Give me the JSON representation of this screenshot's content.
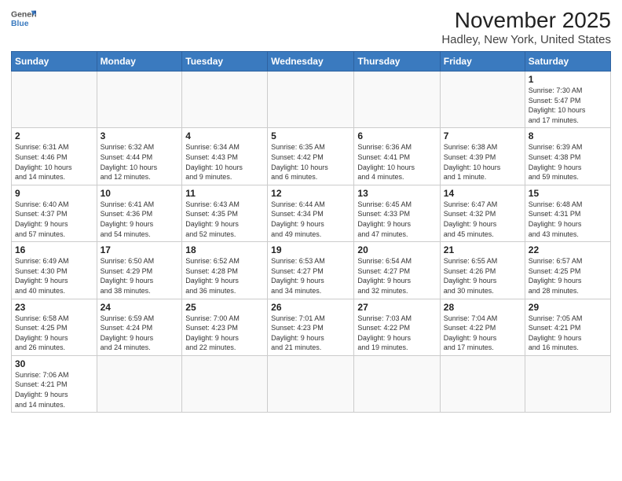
{
  "header": {
    "logo_line1": "General",
    "logo_line2": "Blue",
    "title": "November 2025",
    "subtitle": "Hadley, New York, United States"
  },
  "weekdays": [
    "Sunday",
    "Monday",
    "Tuesday",
    "Wednesday",
    "Thursday",
    "Friday",
    "Saturday"
  ],
  "weeks": [
    [
      {
        "day": "",
        "info": ""
      },
      {
        "day": "",
        "info": ""
      },
      {
        "day": "",
        "info": ""
      },
      {
        "day": "",
        "info": ""
      },
      {
        "day": "",
        "info": ""
      },
      {
        "day": "",
        "info": ""
      },
      {
        "day": "1",
        "info": "Sunrise: 7:30 AM\nSunset: 5:47 PM\nDaylight: 10 hours\nand 17 minutes."
      }
    ],
    [
      {
        "day": "2",
        "info": "Sunrise: 6:31 AM\nSunset: 4:46 PM\nDaylight: 10 hours\nand 14 minutes."
      },
      {
        "day": "3",
        "info": "Sunrise: 6:32 AM\nSunset: 4:44 PM\nDaylight: 10 hours\nand 12 minutes."
      },
      {
        "day": "4",
        "info": "Sunrise: 6:34 AM\nSunset: 4:43 PM\nDaylight: 10 hours\nand 9 minutes."
      },
      {
        "day": "5",
        "info": "Sunrise: 6:35 AM\nSunset: 4:42 PM\nDaylight: 10 hours\nand 6 minutes."
      },
      {
        "day": "6",
        "info": "Sunrise: 6:36 AM\nSunset: 4:41 PM\nDaylight: 10 hours\nand 4 minutes."
      },
      {
        "day": "7",
        "info": "Sunrise: 6:38 AM\nSunset: 4:39 PM\nDaylight: 10 hours\nand 1 minute."
      },
      {
        "day": "8",
        "info": "Sunrise: 6:39 AM\nSunset: 4:38 PM\nDaylight: 9 hours\nand 59 minutes."
      }
    ],
    [
      {
        "day": "9",
        "info": "Sunrise: 6:40 AM\nSunset: 4:37 PM\nDaylight: 9 hours\nand 57 minutes."
      },
      {
        "day": "10",
        "info": "Sunrise: 6:41 AM\nSunset: 4:36 PM\nDaylight: 9 hours\nand 54 minutes."
      },
      {
        "day": "11",
        "info": "Sunrise: 6:43 AM\nSunset: 4:35 PM\nDaylight: 9 hours\nand 52 minutes."
      },
      {
        "day": "12",
        "info": "Sunrise: 6:44 AM\nSunset: 4:34 PM\nDaylight: 9 hours\nand 49 minutes."
      },
      {
        "day": "13",
        "info": "Sunrise: 6:45 AM\nSunset: 4:33 PM\nDaylight: 9 hours\nand 47 minutes."
      },
      {
        "day": "14",
        "info": "Sunrise: 6:47 AM\nSunset: 4:32 PM\nDaylight: 9 hours\nand 45 minutes."
      },
      {
        "day": "15",
        "info": "Sunrise: 6:48 AM\nSunset: 4:31 PM\nDaylight: 9 hours\nand 43 minutes."
      }
    ],
    [
      {
        "day": "16",
        "info": "Sunrise: 6:49 AM\nSunset: 4:30 PM\nDaylight: 9 hours\nand 40 minutes."
      },
      {
        "day": "17",
        "info": "Sunrise: 6:50 AM\nSunset: 4:29 PM\nDaylight: 9 hours\nand 38 minutes."
      },
      {
        "day": "18",
        "info": "Sunrise: 6:52 AM\nSunset: 4:28 PM\nDaylight: 9 hours\nand 36 minutes."
      },
      {
        "day": "19",
        "info": "Sunrise: 6:53 AM\nSunset: 4:27 PM\nDaylight: 9 hours\nand 34 minutes."
      },
      {
        "day": "20",
        "info": "Sunrise: 6:54 AM\nSunset: 4:27 PM\nDaylight: 9 hours\nand 32 minutes."
      },
      {
        "day": "21",
        "info": "Sunrise: 6:55 AM\nSunset: 4:26 PM\nDaylight: 9 hours\nand 30 minutes."
      },
      {
        "day": "22",
        "info": "Sunrise: 6:57 AM\nSunset: 4:25 PM\nDaylight: 9 hours\nand 28 minutes."
      }
    ],
    [
      {
        "day": "23",
        "info": "Sunrise: 6:58 AM\nSunset: 4:25 PM\nDaylight: 9 hours\nand 26 minutes."
      },
      {
        "day": "24",
        "info": "Sunrise: 6:59 AM\nSunset: 4:24 PM\nDaylight: 9 hours\nand 24 minutes."
      },
      {
        "day": "25",
        "info": "Sunrise: 7:00 AM\nSunset: 4:23 PM\nDaylight: 9 hours\nand 22 minutes."
      },
      {
        "day": "26",
        "info": "Sunrise: 7:01 AM\nSunset: 4:23 PM\nDaylight: 9 hours\nand 21 minutes."
      },
      {
        "day": "27",
        "info": "Sunrise: 7:03 AM\nSunset: 4:22 PM\nDaylight: 9 hours\nand 19 minutes."
      },
      {
        "day": "28",
        "info": "Sunrise: 7:04 AM\nSunset: 4:22 PM\nDaylight: 9 hours\nand 17 minutes."
      },
      {
        "day": "29",
        "info": "Sunrise: 7:05 AM\nSunset: 4:21 PM\nDaylight: 9 hours\nand 16 minutes."
      }
    ],
    [
      {
        "day": "30",
        "info": "Sunrise: 7:06 AM\nSunset: 4:21 PM\nDaylight: 9 hours\nand 14 minutes."
      },
      {
        "day": "",
        "info": ""
      },
      {
        "day": "",
        "info": ""
      },
      {
        "day": "",
        "info": ""
      },
      {
        "day": "",
        "info": ""
      },
      {
        "day": "",
        "info": ""
      },
      {
        "day": "",
        "info": ""
      }
    ]
  ]
}
